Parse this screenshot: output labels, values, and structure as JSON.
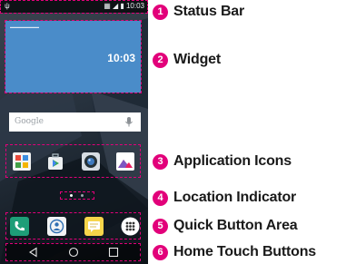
{
  "status_bar": {
    "time": "10:03"
  },
  "widget": {
    "time": "10:03"
  },
  "search_widget": {
    "label": "Google"
  },
  "callouts": [
    {
      "number": "1",
      "label": "Status Bar"
    },
    {
      "number": "2",
      "label": "Widget"
    },
    {
      "number": "3",
      "label": "Application Icons"
    },
    {
      "number": "4",
      "label": "Location Indicator"
    },
    {
      "number": "5",
      "label": "Quick Button Area"
    },
    {
      "number": "6",
      "label": "Home Touch Buttons"
    }
  ],
  "colors": {
    "accent": "#e2007a",
    "widget": "#4a8cc9"
  },
  "app_icons": [
    "app-folder-icon",
    "play-store-icon",
    "camera-icon",
    "gallery-icon"
  ],
  "quick_buttons": [
    "phone-icon",
    "contacts-icon",
    "messaging-icon",
    "apps-icon"
  ],
  "home_buttons": [
    "back-icon",
    "home-icon",
    "recent-apps-icon"
  ]
}
